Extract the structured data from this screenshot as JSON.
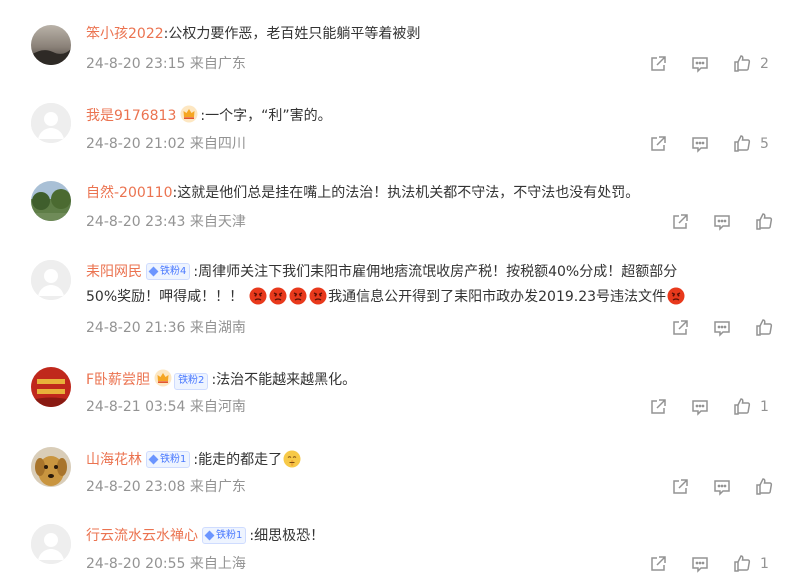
{
  "comments": [
    {
      "username": "笨小孩2022",
      "text": ":公权力要作恶，老百姓只能躺平等着被剥",
      "time": "24-8-20 23:15",
      "location": "来自广东",
      "likes": "2",
      "badge": null
    },
    {
      "username": "我是9176813",
      "text": ":一个字，“利”害的。",
      "time": "24-8-20 21:02",
      "location": "来自四川",
      "likes": "5",
      "badge": "crown"
    },
    {
      "username": "自然-200110",
      "text": ":这就是他们总是挂在嘴上的法治！执法机关都不守法，不守法也没有处罚。",
      "time": "24-8-20 23:43",
      "location": "来自天津",
      "likes": "",
      "badge": null
    },
    {
      "username": "耒阳网民",
      "badge_text": "铁粉4",
      "text_part1": ":周律师关注下我们耒阳市雇佣地痞流氓收房产税！按税额40%分成！超额部分",
      "text_part2": "50%奖励！呷得咸！！！",
      "text_part3": "我通信息公开得到了耒阳市政办发2019.23号违法文件",
      "time": "24-8-20 21:36",
      "location": "来自湖南",
      "likes": "",
      "badge": "fan"
    },
    {
      "username": "F卧薪尝胆",
      "badge_text": "铁粉2",
      "text": ":法治不能越来越黑化。",
      "time": "24-8-21 03:54",
      "location": "来自河南",
      "likes": "1",
      "badge": "crownfan"
    },
    {
      "username": "山海花林",
      "badge_text": "铁粉1",
      "text": ":能走的都走了",
      "time": "24-8-20 23:08",
      "location": "来自广东",
      "likes": "",
      "badge": "fan"
    },
    {
      "username": "行云流水云水禅心",
      "badge_text": "铁粉1",
      "text": ":细思极恐！",
      "time": "24-8-20 20:55",
      "location": "来自上海",
      "likes": "1",
      "badge": "fan"
    }
  ],
  "colors": {
    "username": "#eb7350",
    "meta": "#939393",
    "text": "#333333",
    "fan_badge": "#4a79ff"
  },
  "icons": [
    "share-icon",
    "reply-icon",
    "like-icon",
    "crown-badge-icon",
    "angry-face-emoji",
    "shushing-face-emoji"
  ]
}
